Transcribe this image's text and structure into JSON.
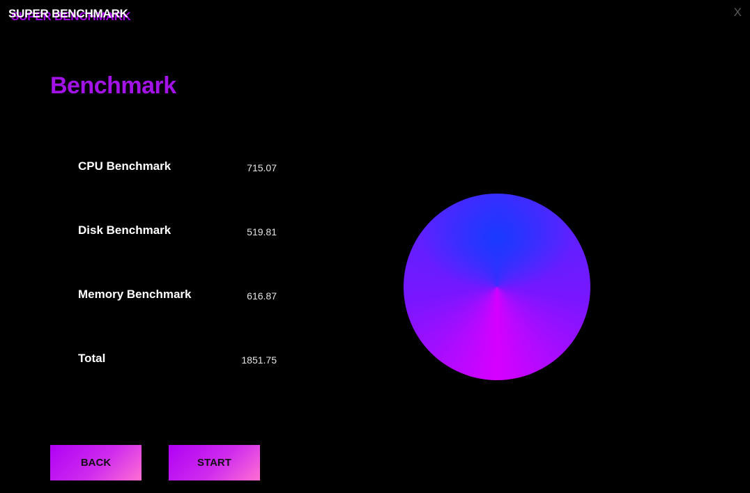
{
  "app": {
    "title": "SUPER BENCHMARK",
    "close_label": "X"
  },
  "page": {
    "title": "Benchmark"
  },
  "results": [
    {
      "label": "CPU Benchmark",
      "value": "715.07"
    },
    {
      "label": "Disk Benchmark",
      "value": "519.81"
    },
    {
      "label": "Memory Benchmark",
      "value": "616.87"
    },
    {
      "label": "Total",
      "value": "1851.75"
    }
  ],
  "buttons": {
    "back_label": "BACK",
    "start_label": "START"
  },
  "colors": {
    "background": "#000000",
    "accent": "#a312e6",
    "button_gradient_start": "#b000f5",
    "button_gradient_end": "#ff6fd2",
    "gauge_top": "#1a3cff",
    "gauge_bottom": "#d600ff"
  }
}
